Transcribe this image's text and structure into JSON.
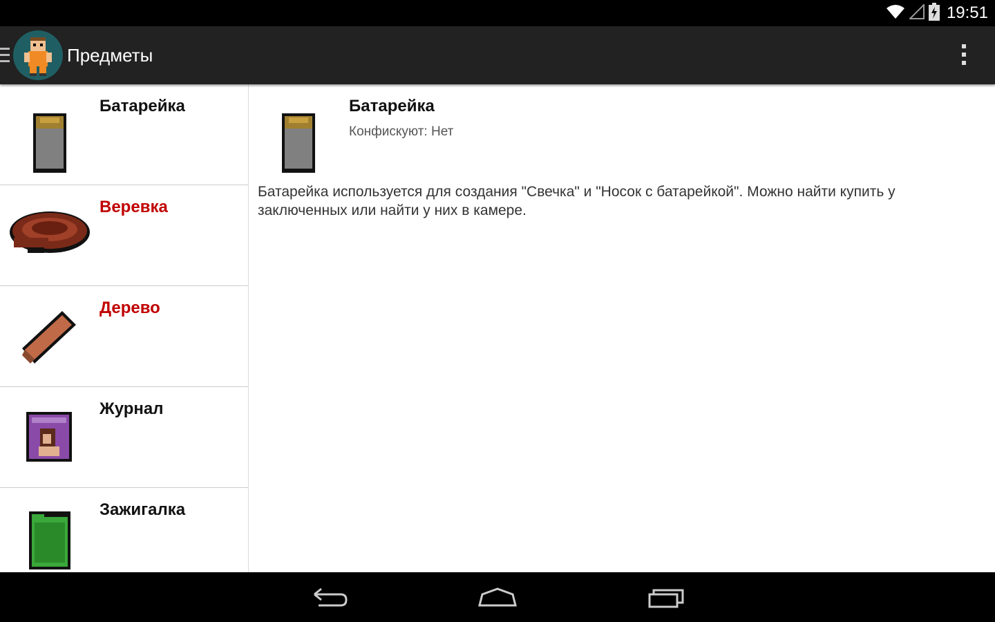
{
  "status_bar": {
    "time": "19:51",
    "icons": [
      "wifi-icon",
      "signal-icon",
      "battery-charging-icon"
    ]
  },
  "action_bar": {
    "title": "Предметы",
    "icons": [
      "drawer-indicator-icon",
      "prisoner-app-icon",
      "overflow-menu-icon"
    ]
  },
  "items": [
    {
      "name": "Батарейка",
      "highlight": false,
      "icon": "battery-item-icon"
    },
    {
      "name": "Веревка",
      "highlight": true,
      "icon": "rope-item-icon"
    },
    {
      "name": "Дерево",
      "highlight": true,
      "icon": "wood-item-icon"
    },
    {
      "name": "Журнал",
      "highlight": false,
      "icon": "magazine-item-icon"
    },
    {
      "name": "Зажигалка",
      "highlight": false,
      "icon": "lighter-item-icon"
    }
  ],
  "detail": {
    "name": "Батарейка",
    "confiscate": "Конфискуют: Нет",
    "description": "Батарейка используется для создания \"Свечка\" и \"Носок с батарейкой\". Можно найти купить у заключенных или найти у них в камере."
  },
  "colors": {
    "highlight": "#c00000",
    "action_bar": "#222222",
    "status_bar": "#000000"
  },
  "nav_bar": {
    "icons": [
      "back-icon",
      "home-icon",
      "recents-icon"
    ]
  }
}
